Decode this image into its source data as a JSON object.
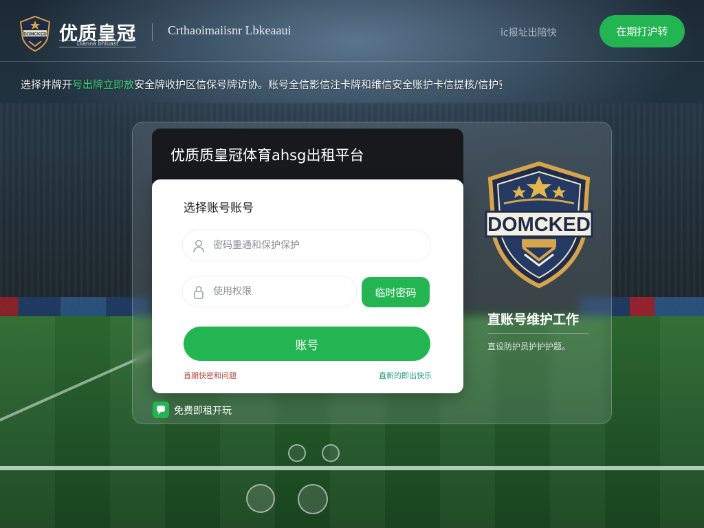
{
  "header": {
    "logo_text": "DOMCKED",
    "brand": "优质皇冠",
    "brand_sub": "Dianna bhluast",
    "tagline": "Crthaoimaiisnr  Lbkeaaui",
    "link": "ic报址出陪快",
    "cta": "在期打沪转"
  },
  "notice": {
    "prefix": "选择并牌开",
    "highlight": "号出牌立即放",
    "suffix": "安全牌收护区信保号牌访协。账号全信影信注卡牌和维信安全账护卡信提核/信护安全账户问题。"
  },
  "card": {
    "title": "优质质皇冠体育ahsg出租平台",
    "section": "选择账号账号",
    "username_placeholder": "密码重通和保护保护",
    "password_placeholder": "使用权限",
    "code_button": "临时密码",
    "submit": "账号",
    "link_left": "首期快密和问题",
    "link_right": "直新的即出快乐"
  },
  "chat": {
    "label": "免费即租开玩"
  },
  "side": {
    "emblem_text": "DOMCKED",
    "title": "直账号维护工作",
    "subtitle": "直设防护员护护护题。"
  },
  "colors": {
    "accent": "#22b551",
    "card_head": "#17191c",
    "link_warning": "#b0443c",
    "link_info": "#1e9b73"
  }
}
